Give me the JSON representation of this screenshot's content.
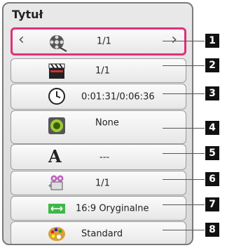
{
  "panel": {
    "title": "Tytuł"
  },
  "rows": [
    {
      "value": "1/1",
      "icon": "film-reel-icon"
    },
    {
      "value": "1/1",
      "icon": "clapperboard-icon"
    },
    {
      "value": "0:01:31/0:06:36",
      "icon": "clock-icon"
    },
    {
      "value": "None",
      "icon": "speaker-icon"
    },
    {
      "value": "---",
      "icon": "subtitle-a-icon"
    },
    {
      "value": "1/1",
      "icon": "camera-icon"
    },
    {
      "value": "16:9 Oryginalne",
      "icon": "aspect-ratio-icon"
    },
    {
      "value": "Standard",
      "icon": "palette-icon"
    }
  ],
  "callouts": [
    "1",
    "2",
    "3",
    "4",
    "5",
    "6",
    "7",
    "8"
  ],
  "arrows": {
    "left": "‹",
    "right": "›"
  }
}
